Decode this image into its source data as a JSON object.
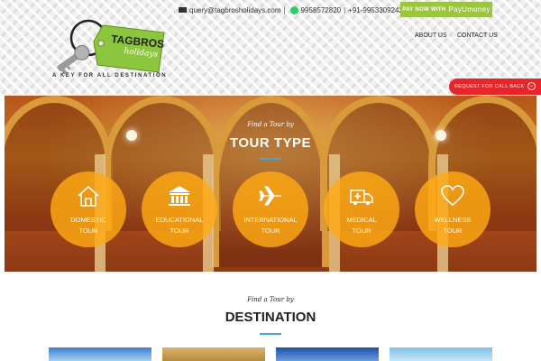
{
  "brand": {
    "logo_text_1": "TAGBROS",
    "logo_text_2": "holidays",
    "tagline": "A KEY FOR ALL DESTINATION"
  },
  "contact": {
    "email": "query@tagbrosholidays.com",
    "whatsapp": "9958572820",
    "phones": "+91-9953309242/9958572820",
    "separator": "|"
  },
  "pay_button": {
    "label": "PAY NOW WITH",
    "brand": "PayUmoney"
  },
  "nav": {
    "about": "ABOUT US",
    "contact": "CONTACT US"
  },
  "callback": {
    "label": "REQUEST FOR CALL BACK"
  },
  "hero": {
    "subtitle": "Find a Tour by",
    "title": "TOUR TYPE",
    "tours": [
      {
        "label_1": "DOMESTIC",
        "label_2": "TOUR",
        "icon": "home-icon"
      },
      {
        "label_1": "EDUCATIONAL",
        "label_2": "TOUR",
        "icon": "institution-icon"
      },
      {
        "label_1": "INTERNATIONAL",
        "label_2": "TOUR",
        "icon": "airplane-icon"
      },
      {
        "label_1": "MEDICAL",
        "label_2": "TOUR",
        "icon": "ambulance-icon"
      },
      {
        "label_1": "WELLNESS",
        "label_2": "TOUR",
        "icon": "heart-icon"
      }
    ]
  },
  "destination": {
    "subtitle": "Find a Tour by",
    "title": "DESTINATION"
  },
  "colors": {
    "accent_green": "#9bc53d",
    "callback_red": "#e8262a",
    "tour_orange": "#ffaa14",
    "underline_blue": "#4aa3df"
  }
}
